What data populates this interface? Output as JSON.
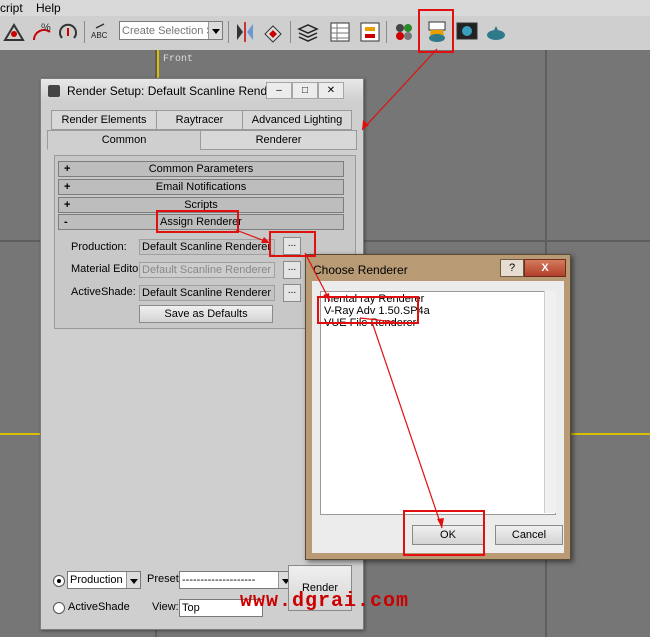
{
  "menubar": {
    "items": [
      "cript",
      "Help"
    ]
  },
  "toolbar": {
    "selection_set_placeholder": "Create Selection Set",
    "abc_label": "ABC"
  },
  "viewport": {
    "label": "Front"
  },
  "render_setup": {
    "title": "Render Setup: Default Scanline Rend...",
    "tabs_row1": [
      "Render Elements",
      "Raytracer",
      "Advanced Lighting"
    ],
    "tabs_row2": [
      "Common",
      "Renderer"
    ],
    "rollouts": [
      {
        "sign": "+",
        "label": "Common Parameters"
      },
      {
        "sign": "+",
        "label": "Email Notifications"
      },
      {
        "sign": "+",
        "label": "Scripts"
      },
      {
        "sign": "-",
        "label": "Assign Renderer"
      }
    ],
    "assign": {
      "production_label": "Production:",
      "production_value": "Default Scanline Renderer",
      "material_label": "Material Editor:",
      "material_value": "Default Scanline Renderer",
      "activeshade_label": "ActiveShade:",
      "activeshade_value": "Default Scanline Renderer",
      "dots": "...",
      "save_defaults": "Save as Defaults"
    },
    "bottom": {
      "production_radio": "Production",
      "activeshade_radio": "ActiveShade",
      "preset_label": "Preset:",
      "preset_value": "--------------------",
      "view_label": "View:",
      "view_value": "Top",
      "render_button": "Render"
    }
  },
  "choose_renderer": {
    "title": "Choose Renderer",
    "help": "?",
    "close": "X",
    "items": [
      "mental ray Renderer",
      "V-Ray Adv 1.50.SP4a",
      "VUE File Renderer"
    ],
    "ok": "OK",
    "cancel": "Cancel"
  },
  "watermark": "www.dgrai.com",
  "colors": {
    "highlight": "#e01010",
    "dialog_frame": "#b89a74"
  }
}
